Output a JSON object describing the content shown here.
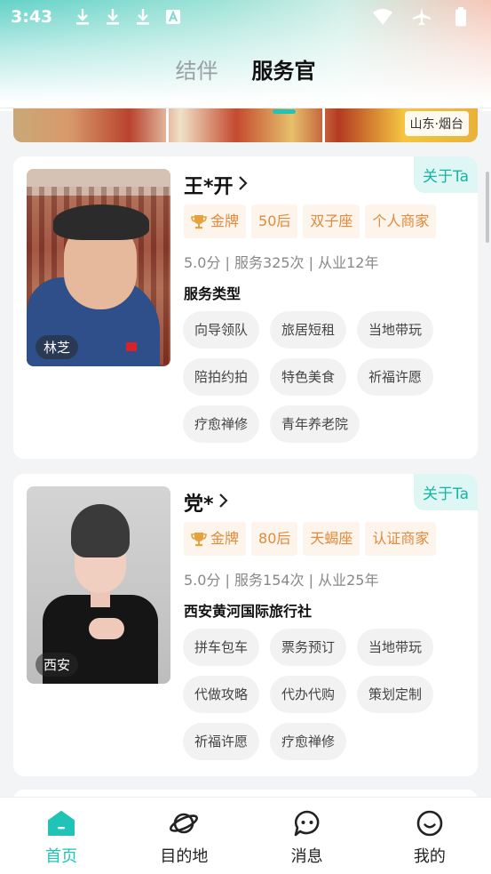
{
  "status_bar": {
    "time": "3:43",
    "left_icons": [
      "download-icon",
      "download-icon",
      "download-icon",
      "keyboard-a-icon"
    ],
    "right_icons": [
      "wifi-icon",
      "airplane-icon",
      "battery-icon"
    ]
  },
  "tabs": [
    {
      "label": "结伴",
      "active": false
    },
    {
      "label": "服务官",
      "active": true
    }
  ],
  "banner": {
    "location": "山东·烟台"
  },
  "cards": [
    {
      "name": "王*开",
      "location": "林芝",
      "about_label": "关于Ta",
      "badges": [
        "金牌",
        "50后",
        "双子座",
        "个人商家"
      ],
      "stats": "5.0分 | 服务325次 | 从业12年",
      "section_title": "服务类型",
      "services": [
        "向导领队",
        "旅居短租",
        "当地带玩",
        "陪拍约拍",
        "特色美食",
        "祈福许愿",
        "疗愈禅修",
        "青年养老院"
      ]
    },
    {
      "name": "党*",
      "location": "西安",
      "about_label": "关于Ta",
      "badges": [
        "金牌",
        "80后",
        "天蝎座",
        "认证商家"
      ],
      "stats": "5.0分 | 服务154次 | 从业25年",
      "section_title": "西安黄河国际旅行社",
      "services": [
        "拼车包车",
        "票务预订",
        "当地带玩",
        "代做攻略",
        "代办代购",
        "策划定制",
        "祈福许愿",
        "疗愈禅修"
      ]
    }
  ],
  "bottom_nav": [
    {
      "label": "首页",
      "icon": "home-icon",
      "active": true
    },
    {
      "label": "目的地",
      "icon": "planet-icon",
      "active": false
    },
    {
      "label": "消息",
      "icon": "message-icon",
      "active": false
    },
    {
      "label": "我的",
      "icon": "smile-icon",
      "active": false
    }
  ],
  "colors": {
    "accent": "#1fc4b6",
    "badge_text": "#e08a3c",
    "badge_bg": "#fdf4ec",
    "about_bg": "#dff7f4"
  }
}
